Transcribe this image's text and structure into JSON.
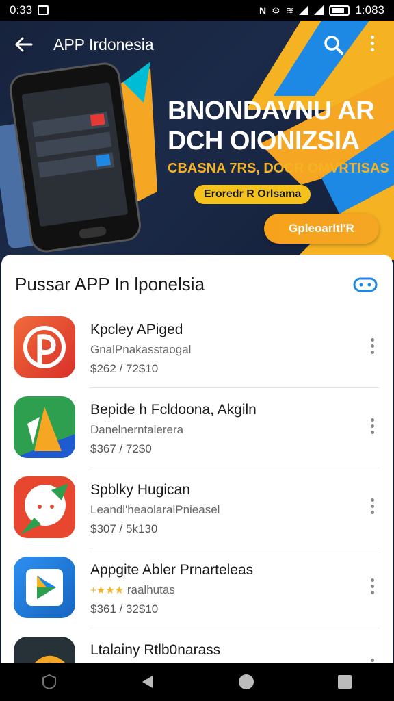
{
  "status_bar": {
    "time_left": "0:33",
    "time_right": "1:083"
  },
  "header": {
    "title": "APP Irdonesia",
    "back_icon": "arrow-left-icon",
    "search_icon": "search-icon",
    "more_icon": "more-vert-icon"
  },
  "hero": {
    "headline_line1": "BNONDAVNU AR",
    "headline_line2": "DCH OIONIZSIA",
    "subline": "CBASNA 7RS, DOCR OMVRTISAS",
    "pill": "Eroredr R Orlsama",
    "cta": "Gpleoarltl'R",
    "colors": {
      "accent": "#f5b323",
      "stripe_blue": "#1e88e5"
    }
  },
  "section": {
    "title": "Pussar APP In lponelsia",
    "icon": "gamepad-icon"
  },
  "apps": [
    {
      "name": "Kpcley APiged",
      "sub": "GnalPnakasstaogal",
      "price": "$262 / 72$10",
      "icon": "p-logo-icon",
      "color": "#e8472f"
    },
    {
      "name": "Bepide h Fcldoona, Akgiln",
      "sub": "Danelnerntalerera",
      "price": "$367 / 72$0",
      "icon": "triangle-logo-icon",
      "color": "#34a853"
    },
    {
      "name": "Spblky Hugican",
      "sub": "Leandl'heaolaralPnieasel",
      "price": "$307 / 5k130",
      "icon": "chat-logo-icon",
      "color": "#e8472f"
    },
    {
      "name": "Appgite Abler Prnarteleas",
      "sub": "raalhutas",
      "stars": "+★★★",
      "price": "$361 / 32$10",
      "icon": "play-logo-icon",
      "color": "#1e88e5"
    },
    {
      "name": "Ltalainy Rtlb0narass",
      "sub": "",
      "price": "",
      "icon": "orange-logo-icon",
      "color": "#263238"
    }
  ],
  "nav": {
    "left_icon": "shield-icon",
    "back_icon": "triangle-back-icon",
    "home_icon": "circle-home-icon",
    "recents_icon": "square-recents-icon"
  }
}
